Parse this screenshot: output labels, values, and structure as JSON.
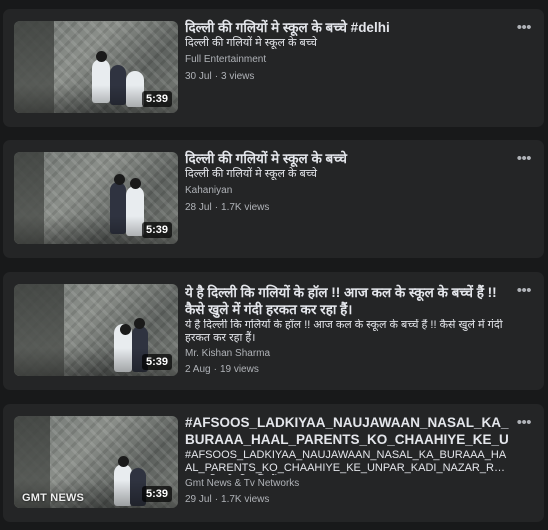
{
  "videos": [
    {
      "title": "दिल्ली की गलियों मे स्कूल के बच्चे #delhi",
      "description": "दिल्ली की गलियों मे स्कूल के बच्चे",
      "channel": "Full Entertainment",
      "date": "30 Jul",
      "views": "3 views",
      "duration": "5:39",
      "watermark": ""
    },
    {
      "title": "दिल्ली की गलियों मे स्कूल के बच्चे",
      "description": "दिल्ली की गलियों मे स्कूल के बच्चे",
      "channel": "Kahaniyan",
      "date": "28 Jul",
      "views": "1.7K views",
      "duration": "5:39",
      "watermark": ""
    },
    {
      "title": "ये है दिल्ली कि गलियों के हॉल !! आज कल के स्कूल के बच्चें हैं !! कैसे खुले में गंदी हरकत कर रहा हैं।",
      "description": "ये है दिल्ली कि गलियों के हॉल !! आज कल के स्कूल के बच्चें हैं !! कैसे खुले में गंदी हरकत कर रहा हैं।",
      "channel": "Mr. Kishan Sharma",
      "date": "2 Aug",
      "views": "19 views",
      "duration": "5:39",
      "watermark": ""
    },
    {
      "title": "#AFSOOS_LADKIYAA_NAUJAWAAN_NASAL_KA_BURAAA_HAAL_PARENTS_KO_CHAAHIYE_KE_UNPAR_KADI_NAZAR_R...",
      "description": "#AFSOOS_LADKIYAA_NAUJAWAAN_NASAL_KA_BURAAA_HAAL_PARENTS_KO_CHAAHIYE_KE_UNPAR_KADI_NAZAR_RAKHE.. दिल्ली की गलियों ...",
      "channel": "Gmt News & Tv Networks",
      "date": "29 Jul",
      "views": "1.7K views",
      "duration": "5:39",
      "watermark": "GMT NEWS"
    }
  ],
  "more_icon": "•••",
  "meta_separator": "·",
  "icons": {
    "more": "more-options-icon"
  }
}
